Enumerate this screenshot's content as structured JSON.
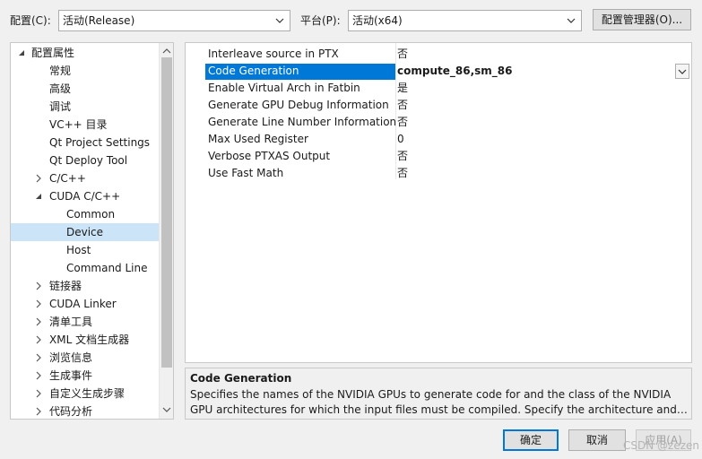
{
  "toolbar": {
    "config_label": "配置(C):",
    "config_value": "活动(Release)",
    "platform_label": "平台(P):",
    "platform_value": "活动(x64)",
    "config_manager_label": "配置管理器(O)..."
  },
  "tree": {
    "items": [
      {
        "label": "配置属性",
        "state": "expanded"
      },
      {
        "label": "常规"
      },
      {
        "label": "高级"
      },
      {
        "label": "调试"
      },
      {
        "label": "VC++ 目录"
      },
      {
        "label": "Qt Project Settings"
      },
      {
        "label": "Qt Deploy Tool"
      },
      {
        "label": "C/C++",
        "state": "collapsed"
      },
      {
        "label": "CUDA C/C++",
        "state": "expanded"
      },
      {
        "label": "Common"
      },
      {
        "label": "Device",
        "selected": true
      },
      {
        "label": "Host"
      },
      {
        "label": "Command Line"
      },
      {
        "label": "链接器",
        "state": "collapsed"
      },
      {
        "label": "CUDA Linker",
        "state": "collapsed"
      },
      {
        "label": "清单工具",
        "state": "collapsed"
      },
      {
        "label": "XML 文档生成器",
        "state": "collapsed"
      },
      {
        "label": "浏览信息",
        "state": "collapsed"
      },
      {
        "label": "生成事件",
        "state": "collapsed"
      },
      {
        "label": "自定义生成步骤",
        "state": "collapsed"
      },
      {
        "label": "代码分析",
        "state": "collapsed"
      }
    ]
  },
  "properties": [
    {
      "name": "Interleave source in PTX",
      "value": "否"
    },
    {
      "name": "Code Generation",
      "value": "compute_86,sm_86",
      "selected": true
    },
    {
      "name": "Enable Virtual Arch in Fatbin",
      "value": "是"
    },
    {
      "name": "Generate GPU Debug Information",
      "value": "否"
    },
    {
      "name": "Generate Line Number Information",
      "value": "否"
    },
    {
      "name": "Max Used Register",
      "value": "0"
    },
    {
      "name": "Verbose PTXAS Output",
      "value": "否"
    },
    {
      "name": "Use Fast Math",
      "value": "否"
    }
  ],
  "description": {
    "title": "Code Generation",
    "line1": "Specifies the names of the NVIDIA GPUs to generate code for and the class of the NVIDIA",
    "line2": "GPU architectures for which the input files must be compiled.  Specify the architecture and co..."
  },
  "buttons": {
    "ok": "确定",
    "cancel": "取消",
    "apply": "应用(A)"
  },
  "watermark": "CSDN @zezen",
  "colors": {
    "selection": "#0078d7",
    "tree_selection": "#cce4f7",
    "background": "#f0f0f0"
  }
}
